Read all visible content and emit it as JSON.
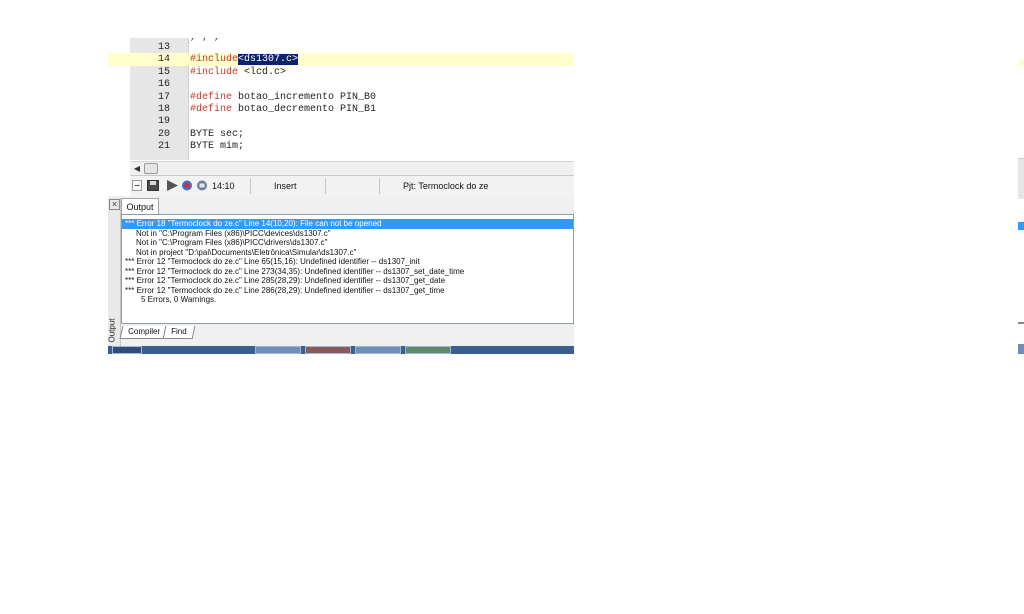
{
  "editor": {
    "partial_top_line": ",  ,      ,",
    "lines": [
      {
        "num": "13",
        "pre": "",
        "kw": "",
        "sel": "",
        "post": ""
      },
      {
        "num": "14",
        "pre": "",
        "kw": "#include",
        "sel": "<ds1307.c>",
        "post": "",
        "current": true
      },
      {
        "num": "15",
        "pre": "",
        "kw": "#include",
        "sel": "",
        "post": " <lcd.c>"
      },
      {
        "num": "16",
        "pre": "",
        "kw": "",
        "sel": "",
        "post": ""
      },
      {
        "num": "17",
        "pre": "",
        "kw": "#define",
        "sel": "",
        "post": " botao_incremento PIN_B0"
      },
      {
        "num": "18",
        "pre": "",
        "kw": "#define",
        "sel": "",
        "post": " botao_decremento PIN_B1"
      },
      {
        "num": "19",
        "pre": "",
        "kw": "",
        "sel": "",
        "post": ""
      },
      {
        "num": "20",
        "pre": "BYTE sec;",
        "kw": "",
        "sel": "",
        "post": ""
      },
      {
        "num": "21",
        "pre": "BYTE mim;",
        "kw": "",
        "sel": "",
        "post": ""
      }
    ]
  },
  "statusbar": {
    "cursor": "14:10",
    "mode": "Insert",
    "project": "Pjt: Termoclock do ze"
  },
  "output": {
    "tab_label": "Output",
    "side_label": "Output",
    "messages": [
      {
        "text": "*** Error 18 \"Termoclock do ze.c\" Line 14(10,20): File can not be opened",
        "kind": "err",
        "selected": true
      },
      {
        "text": "Not in \"C:\\Program Files (x86)\\PICC\\devices\\ds1307.c\"",
        "kind": "ind"
      },
      {
        "text": "Not in \"C:\\Program Files (x86)\\PICC\\drivers\\ds1307.c\"",
        "kind": "ind"
      },
      {
        "text": "Not in project \"D:\\pai\\Documents\\Eletrônica\\Simular\\ds1307.c\"",
        "kind": "ind"
      },
      {
        "text": "*** Error 12 \"Termoclock do ze.c\" Line 65(15,16): Undefined identifier  -- ds1307_init",
        "kind": "err"
      },
      {
        "text": "*** Error 12 \"Termoclock do ze.c\" Line 273(34,35): Undefined identifier  -- ds1307_set_date_time",
        "kind": "err"
      },
      {
        "text": "*** Error 12 \"Termoclock do ze.c\" Line 285(28,29): Undefined identifier  -- ds1307_get_date",
        "kind": "err"
      },
      {
        "text": "*** Error 12 \"Termoclock do ze.c\" Line 286(28,29): Undefined identifier  -- ds1307_get_time",
        "kind": "err"
      },
      {
        "text": "5 Errors,  0 Warnings.",
        "kind": "sum"
      }
    ],
    "bottom_tabs": [
      {
        "label": "Compiler"
      },
      {
        "label": "Find"
      }
    ]
  },
  "colors": {
    "keyword": "#c0392b",
    "selection": "#0a246a",
    "selected_row": "#3399ff",
    "current_line": "#ffffcc"
  },
  "icons": [
    "minimize-icon",
    "save-icon",
    "play-icon",
    "record-icon",
    "stop-icon",
    "close-icon",
    "scroll-left-icon"
  ]
}
